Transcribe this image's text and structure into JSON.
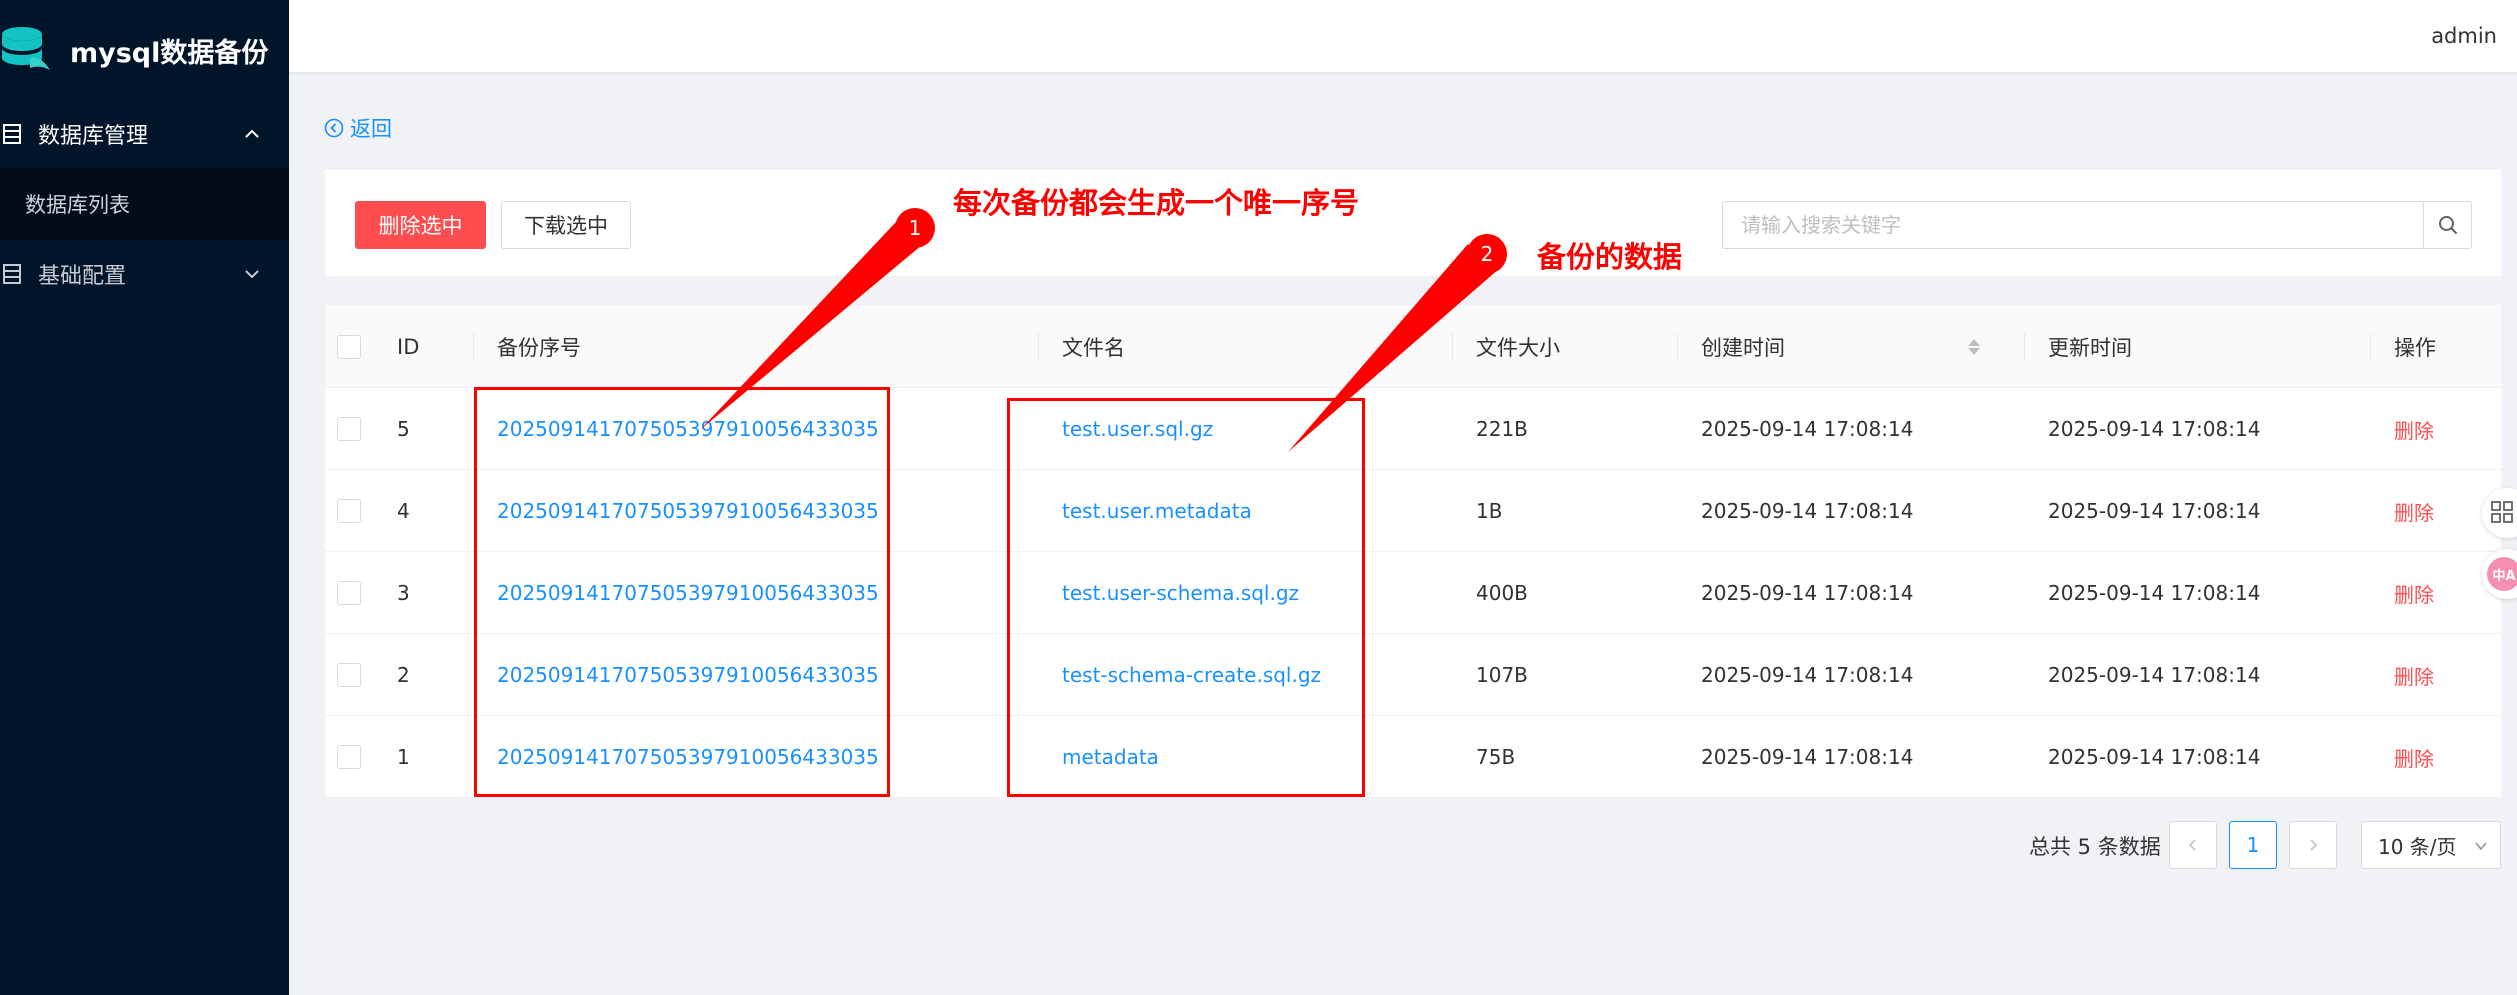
{
  "brand": {
    "title": "mysql数据备份",
    "logo_icon": "database-icon"
  },
  "sidebar": {
    "items": [
      {
        "label": "数据库管理",
        "icon": "table-icon",
        "expanded": true,
        "children": [
          {
            "label": "数据库列表"
          }
        ]
      },
      {
        "label": "基础配置",
        "icon": "table-icon",
        "expanded": false
      }
    ]
  },
  "header": {
    "user": "admin"
  },
  "page": {
    "back_label": "返回"
  },
  "toolbar": {
    "delete_selected": "删除选中",
    "download_selected": "下载选中",
    "search_placeholder": "请输入搜索关键字"
  },
  "table": {
    "columns": [
      "ID",
      "备份序号",
      "文件名",
      "文件大小",
      "创建时间",
      "更新时间",
      "操作"
    ],
    "rows": [
      {
        "id": "5",
        "serial": "20250914170750539791005643303​5",
        "file": "test.user.sql.gz",
        "size": "221B",
        "created": "2025-09-14 17:08:14",
        "updated": "2025-09-14 17:08:14",
        "action": "删除"
      },
      {
        "id": "4",
        "serial": "202509141707505397910056433035",
        "file": "test.user.metadata",
        "size": "1B",
        "created": "2025-09-14 17:08:14",
        "updated": "2025-09-14 17:08:14",
        "action": "删除"
      },
      {
        "id": "3",
        "serial": "202509141707505397910056433035",
        "file": "test.user-schema.sql.gz",
        "size": "400B",
        "created": "2025-09-14 17:08:14",
        "updated": "2025-09-14 17:08:14",
        "action": "删除"
      },
      {
        "id": "2",
        "serial": "202509141707505397910056433035",
        "file": "test-schema-create.sql.gz",
        "size": "107B",
        "created": "2025-09-14 17:08:14",
        "updated": "2025-09-14 17:08:14",
        "action": "删除"
      },
      {
        "id": "1",
        "serial": "202509141707505397910056433035",
        "file": "metadata",
        "size": "75B",
        "created": "2025-09-14 17:08:14",
        "updated": "2025-09-14 17:08:14",
        "action": "删除"
      }
    ]
  },
  "pagination": {
    "total_text": "总共 5 条数据",
    "current_page": "1",
    "page_size": "10 条/页"
  },
  "float_widgets": {
    "translate_badge": "中A"
  },
  "annotations": [
    {
      "number": "1",
      "text": "每次备份都会生成一个唯一序号"
    },
    {
      "number": "2",
      "text": "备份的数据"
    }
  ],
  "colors": {
    "sidebar_bg": "#001529",
    "primary": "#1890ff",
    "danger": "#ff4d4f",
    "annotation": "#ff0000"
  }
}
